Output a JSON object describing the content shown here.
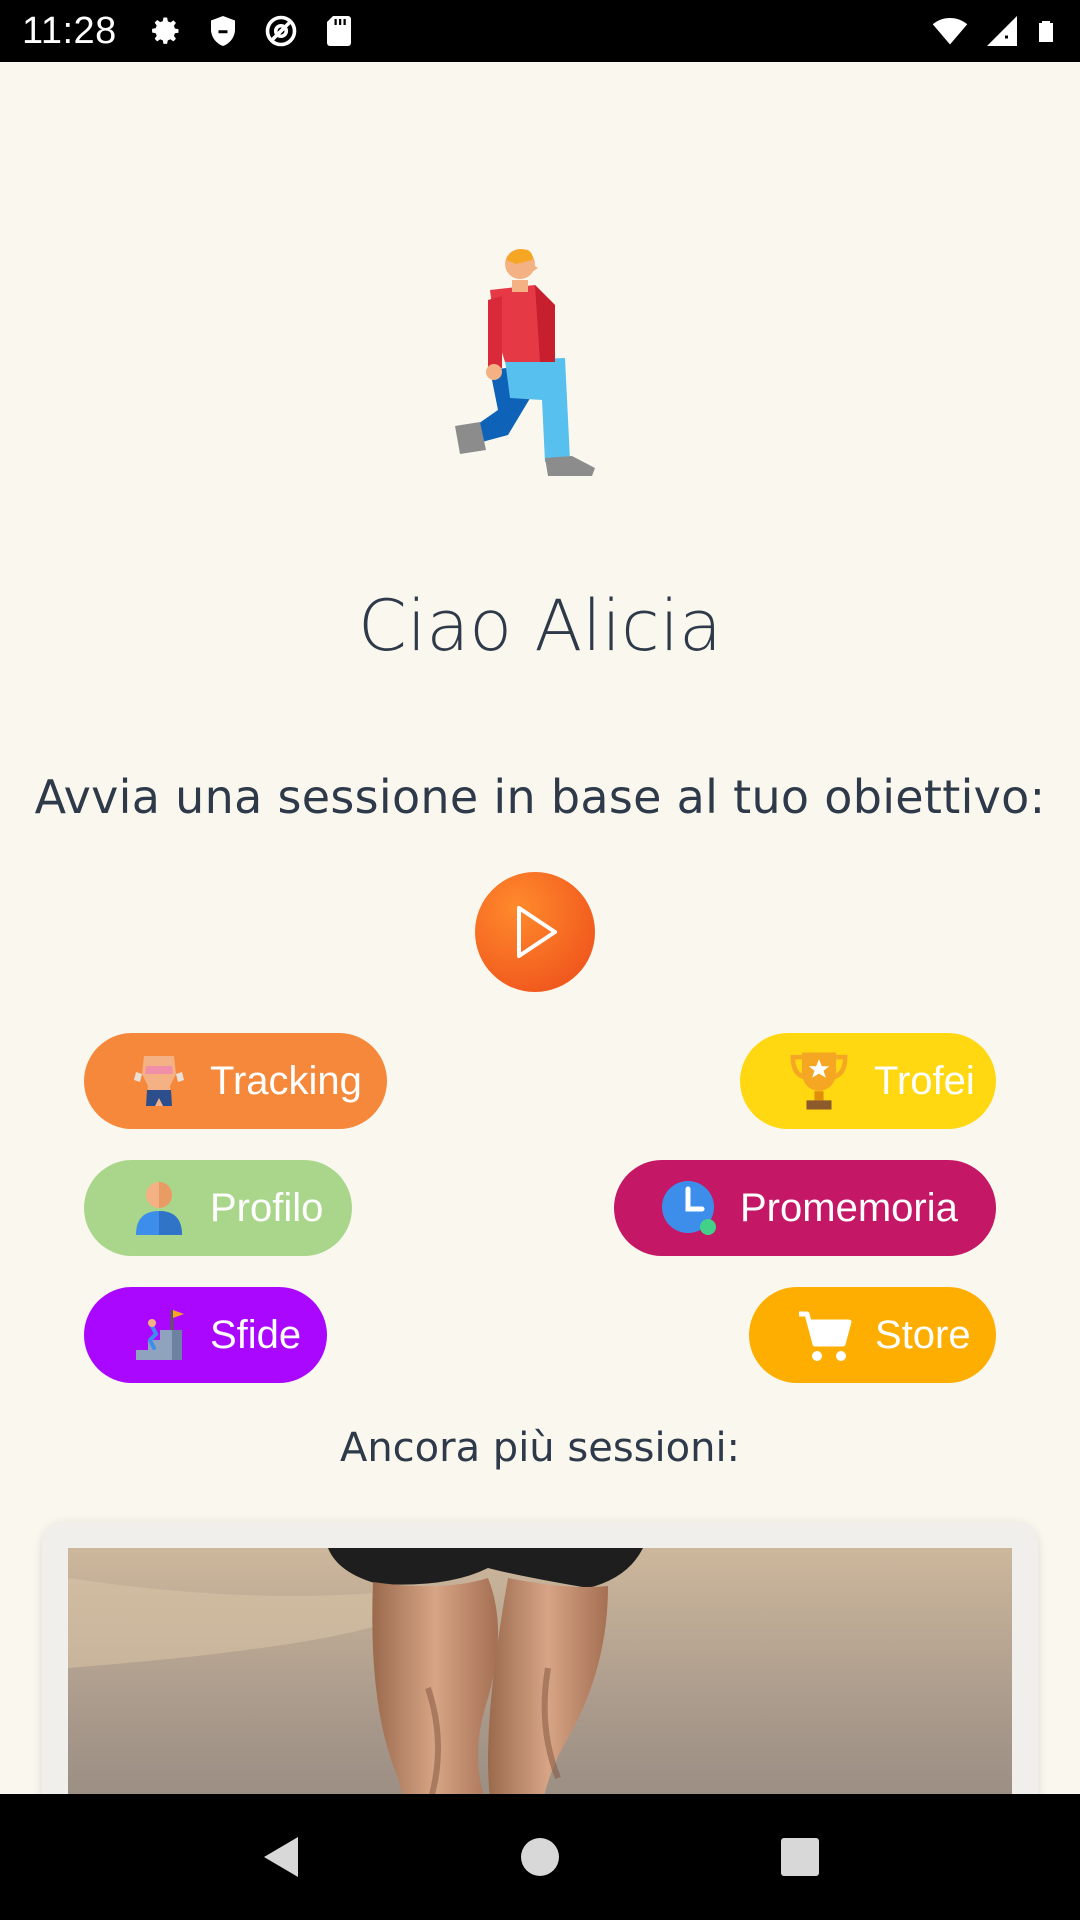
{
  "status_bar": {
    "time": "11:28",
    "icons": [
      "gear-icon",
      "shield-icon",
      "at-sign-icon",
      "sd-card-icon",
      "wifi-icon",
      "signal-icon",
      "battery-icon"
    ]
  },
  "greeting": "Ciao Alicia",
  "subtitle": "Avvia una sessione in base al tuo obiettivo:",
  "play_button": {
    "icon": "play-icon"
  },
  "menu": {
    "tracking": {
      "label": "Tracking",
      "icon": "body-tracking-icon",
      "color": "#F5883A"
    },
    "trofei": {
      "label": "Trofei",
      "icon": "trophy-icon",
      "color": "#FFD812"
    },
    "profilo": {
      "label": "Profilo",
      "icon": "user-icon",
      "color": "#A9D68A"
    },
    "promemoria": {
      "label": "Promemoria",
      "icon": "clock-icon",
      "color": "#C41766"
    },
    "sfide": {
      "label": "Sfide",
      "icon": "stairs-flag-icon",
      "color": "#A907FF"
    },
    "store": {
      "label": "Store",
      "icon": "cart-icon",
      "color": "#FEAE00"
    }
  },
  "more_sessions_label": "Ancora più sessioni:",
  "nav_bar": {
    "icons": [
      "back-icon",
      "home-icon",
      "recents-icon"
    ]
  },
  "colors": {
    "background": "#FAF8EE",
    "text": "#2E3A4A",
    "accent": "#F15A1E"
  }
}
